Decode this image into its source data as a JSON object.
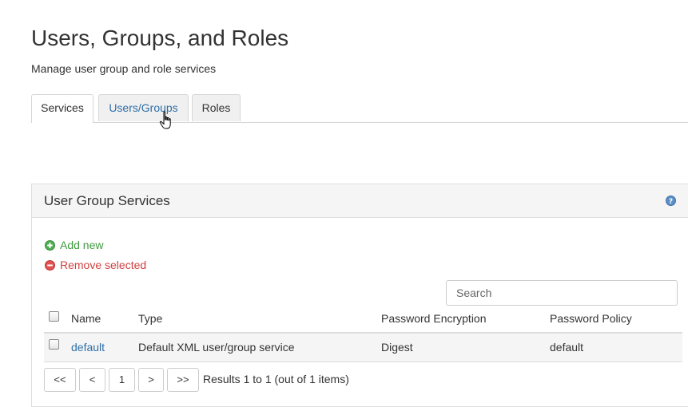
{
  "header": {
    "title": "Users, Groups, and Roles",
    "subtitle": "Manage user group and role services"
  },
  "tabs": [
    {
      "label": "Services",
      "active": true
    },
    {
      "label": "Users/Groups",
      "active": false
    },
    {
      "label": "Roles",
      "active": false
    }
  ],
  "panel": {
    "title": "User Group Services",
    "help_icon": "question-circle-icon",
    "add_label": "Add new",
    "remove_label": "Remove selected",
    "search_placeholder": "Search",
    "columns": [
      "Name",
      "Type",
      "Password Encryption",
      "Password Policy"
    ],
    "rows": [
      {
        "name": "default",
        "type": "Default XML user/group service",
        "encryption": "Digest",
        "policy": "default"
      }
    ],
    "pager": {
      "first": "<<",
      "prev": "<",
      "page": "1",
      "next": ">",
      "last": ">>",
      "results": "Results 1 to 1 (out of 1 items)"
    }
  },
  "colors": {
    "link": "#2f6fa7",
    "add": "#3f9b3f",
    "remove": "#d04040"
  }
}
